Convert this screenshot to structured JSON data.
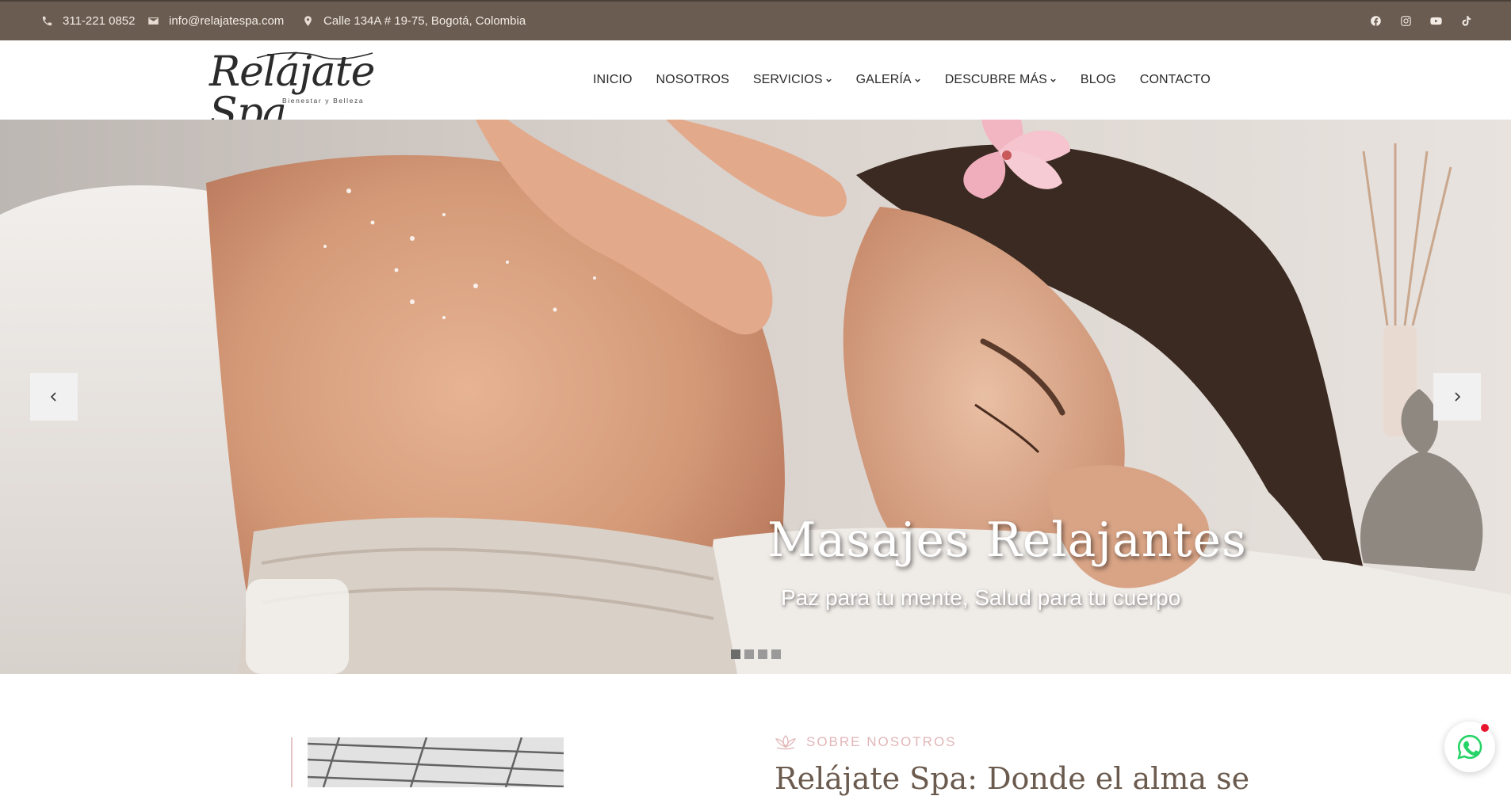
{
  "topbar": {
    "phone": "311-221 0852",
    "email": "info@relajatespa.com",
    "address": "Calle 134A # 19-75, Bogotá, Colombia",
    "socials": [
      "facebook-icon",
      "instagram-icon",
      "youtube-icon",
      "tiktok-icon"
    ]
  },
  "header": {
    "logo_text": "Relájate Spa",
    "logo_tagline": "Bienestar y Belleza",
    "nav": [
      {
        "label": "INICIO",
        "dropdown": false
      },
      {
        "label": "NOSOTROS",
        "dropdown": false
      },
      {
        "label": "SERVICIOS",
        "dropdown": true
      },
      {
        "label": "GALERÍA",
        "dropdown": true
      },
      {
        "label": "DESCUBRE MÁS",
        "dropdown": true
      },
      {
        "label": "BLOG",
        "dropdown": false
      },
      {
        "label": "CONTACTO",
        "dropdown": false
      }
    ]
  },
  "hero": {
    "title": "Masajes Relajantes",
    "subtitle": "Paz para tu mente, Salud para tu cuerpo",
    "slide_count": 4,
    "active_slide": 1
  },
  "about": {
    "eyebrow": "SOBRE NOSOTROS",
    "heading": "Relájate Spa: Donde el alma se"
  },
  "colors": {
    "topbar_bg": "#6a5c50",
    "accent_pink": "#e2b6b8",
    "heading_brown": "#6b5a4e",
    "whatsapp_green": "#25d366"
  }
}
